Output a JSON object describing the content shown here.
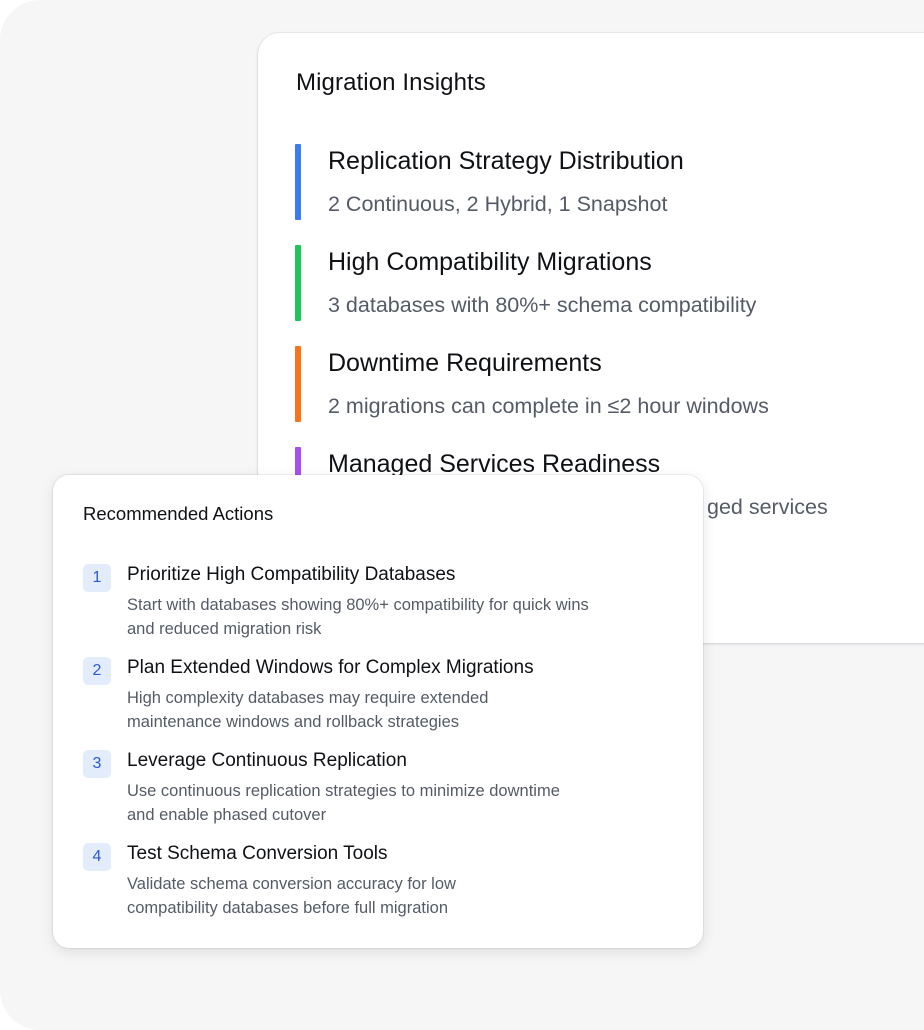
{
  "insights": {
    "title": "Migration Insights",
    "items": [
      {
        "title": "Replication Strategy Distribution",
        "description": "2 Continuous, 2 Hybrid, 1 Snapshot",
        "color": "#3b7cf4"
      },
      {
        "title": "High Compatibility Migrations",
        "description": "3 databases with 80%+ schema compatibility",
        "color": "#1fc45a"
      },
      {
        "title": "Downtime Requirements",
        "description": "2 migrations can complete in ≤2 hour windows",
        "color": "#f9731a"
      },
      {
        "title": "Managed Services Readiness",
        "description": "ged services",
        "color": "#a650f2"
      }
    ]
  },
  "actions": {
    "title": "Recommended Actions",
    "items": [
      {
        "number": "1",
        "title": "Prioritize High Compatibility Databases",
        "line1": "Start with databases showing 80%+ compatibility for quick wins",
        "line2": "and reduced migration risk"
      },
      {
        "number": "2",
        "title": "Plan Extended Windows for Complex Migrations",
        "line1": "High complexity databases may require extended",
        "line2": "maintenance windows and rollback strategies"
      },
      {
        "number": "3",
        "title": "Leverage Continuous Replication",
        "line1": "Use continuous replication strategies to minimize downtime",
        "line2": "and enable phased cutover"
      },
      {
        "number": "4",
        "title": "Test Schema Conversion Tools",
        "line1": "Validate schema conversion accuracy for low",
        "line2": "compatibility databases before full migration"
      }
    ]
  }
}
